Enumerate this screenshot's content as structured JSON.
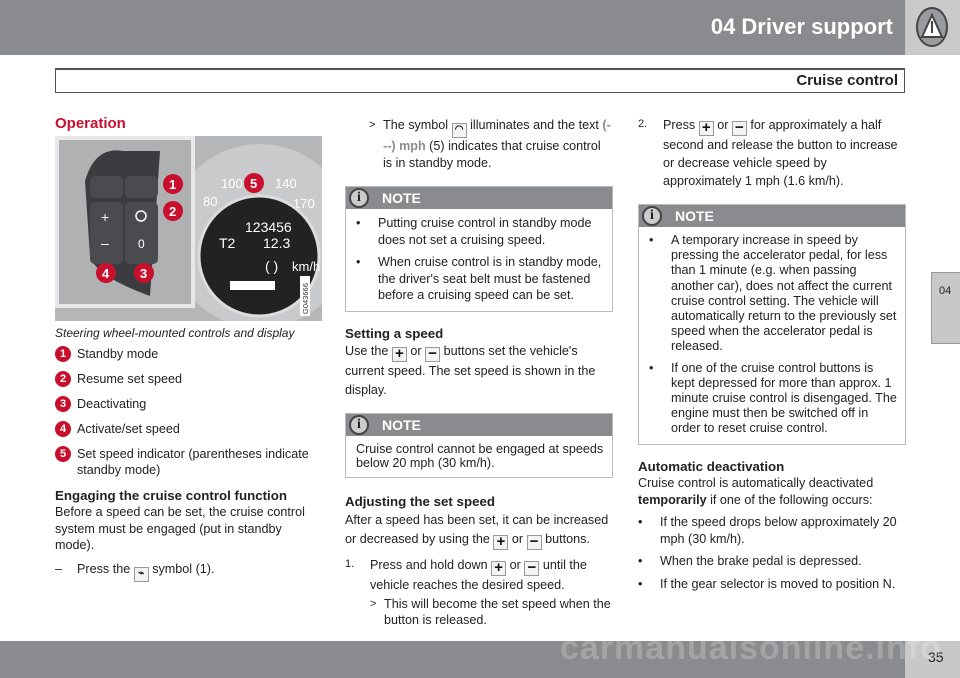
{
  "header": {
    "title": "04  Driver support",
    "icon": "warning-triangle-icon",
    "section": "Cruise control"
  },
  "side_tab": "04",
  "footer": {
    "page": "35",
    "watermark": "carmanualsonline.info"
  },
  "col1": {
    "heading": "Operation",
    "figure": {
      "callouts": [
        "1",
        "2",
        "3",
        "4",
        "5"
      ],
      "odometer": "123456",
      "trip": "T2",
      "trip_value": "12.3",
      "unit": "km/h",
      "speed_ticks": [
        "80",
        "100",
        "140",
        "170"
      ],
      "code": "G043666"
    },
    "caption": "Steering wheel-mounted controls and display",
    "legend": [
      {
        "n": "1",
        "t": "Standby mode"
      },
      {
        "n": "2",
        "t": "Resume set speed"
      },
      {
        "n": "3",
        "t": "Deactivating"
      },
      {
        "n": "4",
        "t": "Activate/set speed"
      },
      {
        "n": "5",
        "t": "Set speed indicator (parentheses indicate standby mode)"
      }
    ],
    "engage_heading": "Engaging the cruise control function",
    "engage_text": "Before a speed can be set, the cruise control system must be engaged (put in standby mode).",
    "step": {
      "marker": "–",
      "pre": "Press the",
      "post": "symbol (1).",
      "icon": "cruise-standby-icon"
    }
  },
  "col2": {
    "result": {
      "marker": ">",
      "pre": "The symbol",
      "post": "illuminates and the text",
      "highlight": "(---) mph",
      "tail": "(5) indicates that cruise control is in standby mode.",
      "icon": "cruise-control-icon"
    },
    "note1": {
      "title": "NOTE",
      "items": [
        "Putting cruise control in standby mode does not set a cruising speed.",
        "When cruise control is in standby mode, the driver's seat belt must be fastened before a cruising speed can be set."
      ]
    },
    "set_heading": "Setting a speed",
    "set_text": {
      "a": "Use the",
      "b": "or",
      "c": "buttons set the vehicle's current speed. The set speed is shown in the display."
    },
    "note2": {
      "title": "NOTE",
      "text": "Cruise control cannot be engaged at speeds below 20 mph (30 km/h)."
    },
    "adjust_heading": "Adjusting the set speed",
    "adjust_text": {
      "a": "After a speed has been set, it can be increased or decreased by using the",
      "b": "or",
      "c": "buttons."
    },
    "step1": {
      "n": "1.",
      "a": "Press and hold down",
      "b": "or",
      "c": "until the vehicle reaches the desired speed."
    },
    "step1_result": {
      "marker": ">",
      "text": "This will become the set speed when the button is released."
    }
  },
  "col3": {
    "step2": {
      "n": "2.",
      "a": "Press",
      "b": "or",
      "c": "for approximately a half second and release the button to increase or decrease vehicle speed by approximately 1 mph (1.6 km/h)."
    },
    "note3": {
      "title": "NOTE",
      "items": [
        "A temporary increase in speed by pressing the accelerator pedal, for less than 1 minute (e.g. when passing another car), does not affect the current cruise control setting. The vehicle will automatically return to the previously set speed when the accelerator pedal is released.",
        "If one of the cruise control buttons is kept depressed for more than approx. 1 minute cruise control is disengaged. The engine must then be switched off in order to reset cruise control."
      ]
    },
    "auto_heading": "Automatic deactivation",
    "auto_text": {
      "a": "Cruise control is automatically deactivated",
      "bold": "temporarily",
      "b": "if one of the following occurs:"
    },
    "auto_items": [
      "If the speed drops below approximately 20 mph (30 km/h).",
      "When the brake pedal is depressed.",
      "If the gear selector is moved to position N."
    ]
  },
  "icons": {
    "plus": "+",
    "minus": "−",
    "info": "i",
    "bullet": "•"
  },
  "colors": {
    "accent": "#c8102e",
    "header": "#8a8b8e",
    "tab": "#c8c8c9"
  }
}
